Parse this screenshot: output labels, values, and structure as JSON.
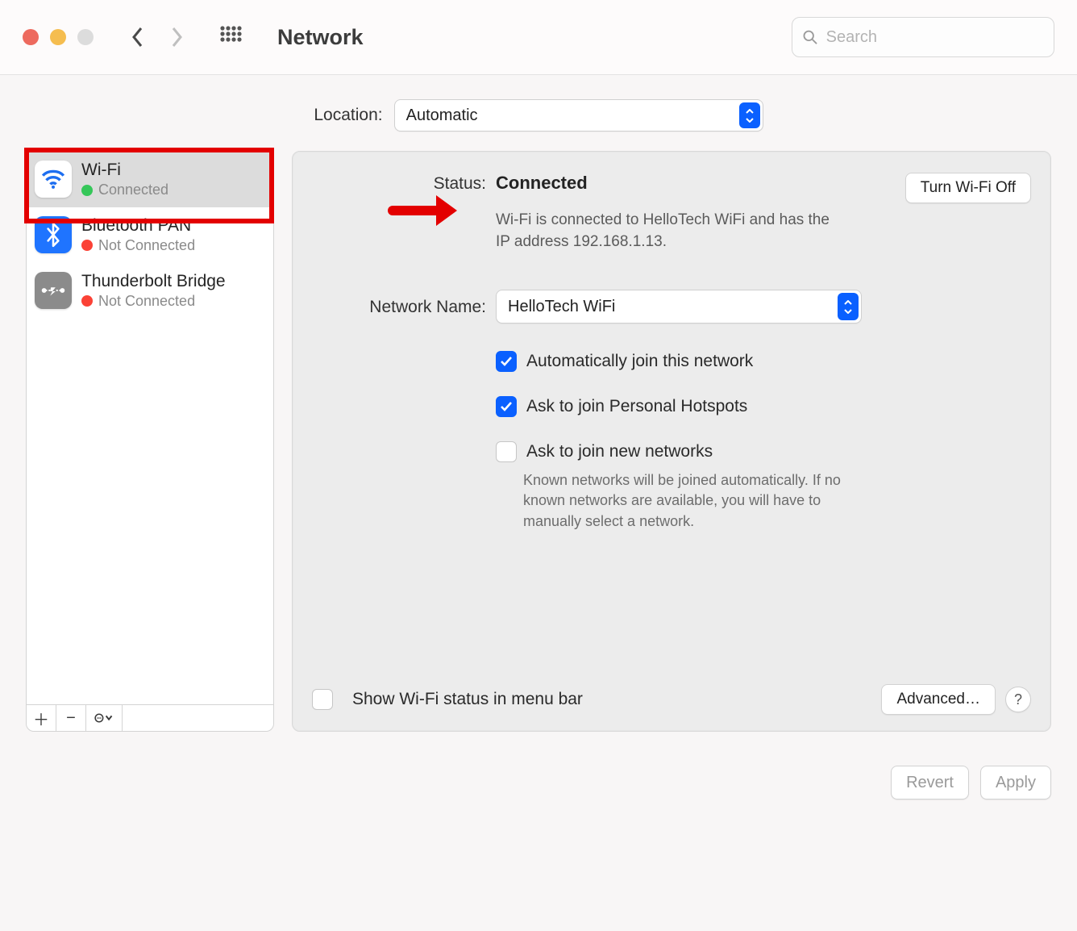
{
  "toolbar": {
    "title": "Network",
    "search_placeholder": "Search"
  },
  "location": {
    "label": "Location:",
    "value": "Automatic"
  },
  "sidebar": {
    "items": [
      {
        "name": "Wi-Fi",
        "status": "Connected",
        "connected": true
      },
      {
        "name": "Bluetooth PAN",
        "status": "Not Connected",
        "connected": false
      },
      {
        "name": "Thunderbolt Bridge",
        "status": "Not Connected",
        "connected": false
      }
    ]
  },
  "detail": {
    "status_label": "Status:",
    "status_value": "Connected",
    "turn_off_label": "Turn Wi-Fi Off",
    "status_description": "Wi-Fi is connected to HelloTech WiFi and has the IP address 192.168.1.13.",
    "network_name_label": "Network Name:",
    "network_name_value": "HelloTech WiFi",
    "auto_join_label": "Automatically join this network",
    "ask_hotspots_label": "Ask to join Personal Hotspots",
    "ask_new_label": "Ask to join new networks",
    "ask_new_hint": "Known networks will be joined automatically. If no known networks are available, you will have to manually select a network.",
    "show_menu_label": "Show Wi-Fi status in menu bar",
    "advanced_label": "Advanced…",
    "help_label": "?"
  },
  "footer": {
    "revert_label": "Revert",
    "apply_label": "Apply"
  }
}
